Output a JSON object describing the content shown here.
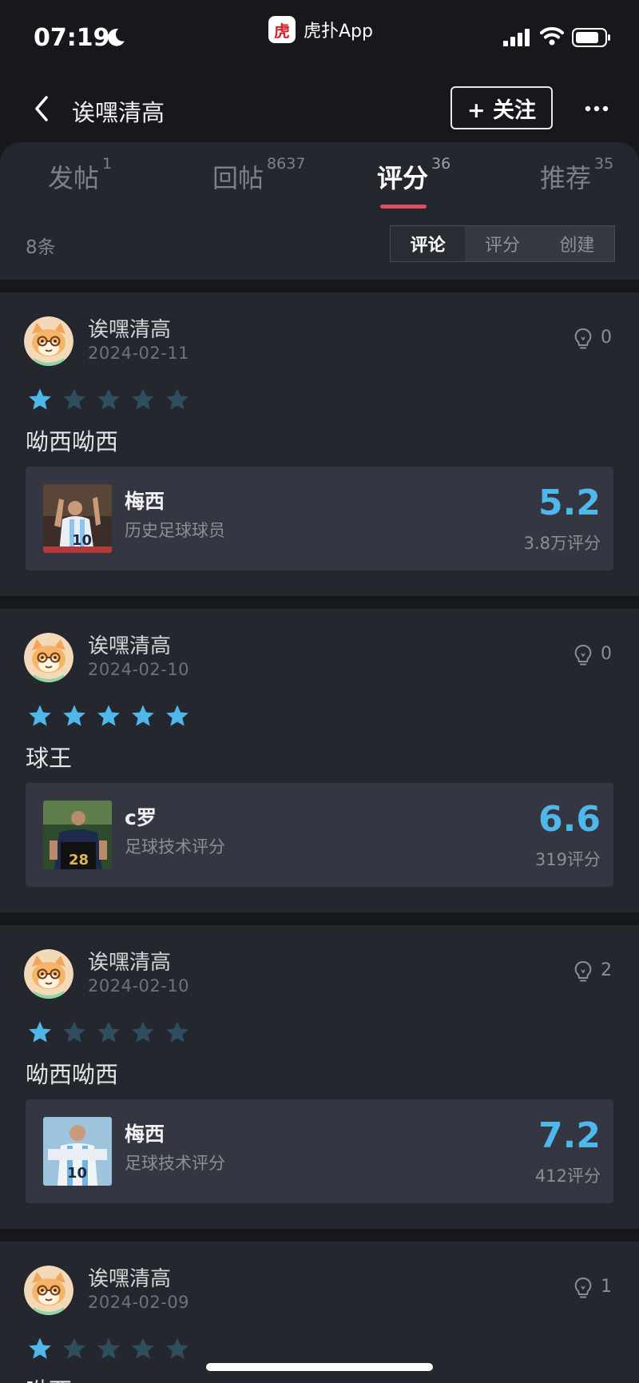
{
  "status_bar": {
    "time": "07:19",
    "app_logo_text": "虎",
    "app_name": "虎扑App"
  },
  "nav": {
    "title": "诶嘿清高",
    "follow_label": "+ 关注"
  },
  "tabs": [
    {
      "label": "发帖",
      "count": "1"
    },
    {
      "label": "回帖",
      "count": "8637"
    },
    {
      "label": "评分",
      "count": "36"
    },
    {
      "label": "推荐",
      "count": "35"
    }
  ],
  "filter": {
    "count_text": "8条",
    "segments": [
      "评论",
      "评分",
      "创建"
    ],
    "active_segment": "评论"
  },
  "colors": {
    "accent": "#e0505c",
    "score": "#4fb7ea",
    "star_on": "#4fb7ea",
    "star_off": "#2e4e5f"
  },
  "cards": [
    {
      "user": "诶嘿清高",
      "date": "2024-02-11",
      "likes": "0",
      "rating": 1,
      "comment": "呦西呦西",
      "subject": {
        "name": "梅西",
        "category": "历史足球球员",
        "score": "5.2",
        "score_count": "3.8万评分"
      }
    },
    {
      "user": "诶嘿清高",
      "date": "2024-02-10",
      "likes": "0",
      "rating": 5,
      "comment": "球王",
      "subject": {
        "name": "c罗",
        "category": "足球技术评分",
        "score": "6.6",
        "score_count": "319评分"
      }
    },
    {
      "user": "诶嘿清高",
      "date": "2024-02-10",
      "likes": "2",
      "rating": 1,
      "comment": "呦西呦西",
      "subject": {
        "name": "梅西",
        "category": "足球技术评分",
        "score": "7.2",
        "score_count": "412评分"
      }
    },
    {
      "user": "诶嘿清高",
      "date": "2024-02-09",
      "likes": "1",
      "rating": 1,
      "comment": "呦西",
      "subject": {
        "name": "",
        "category": "",
        "score": "",
        "score_count": ""
      }
    }
  ]
}
